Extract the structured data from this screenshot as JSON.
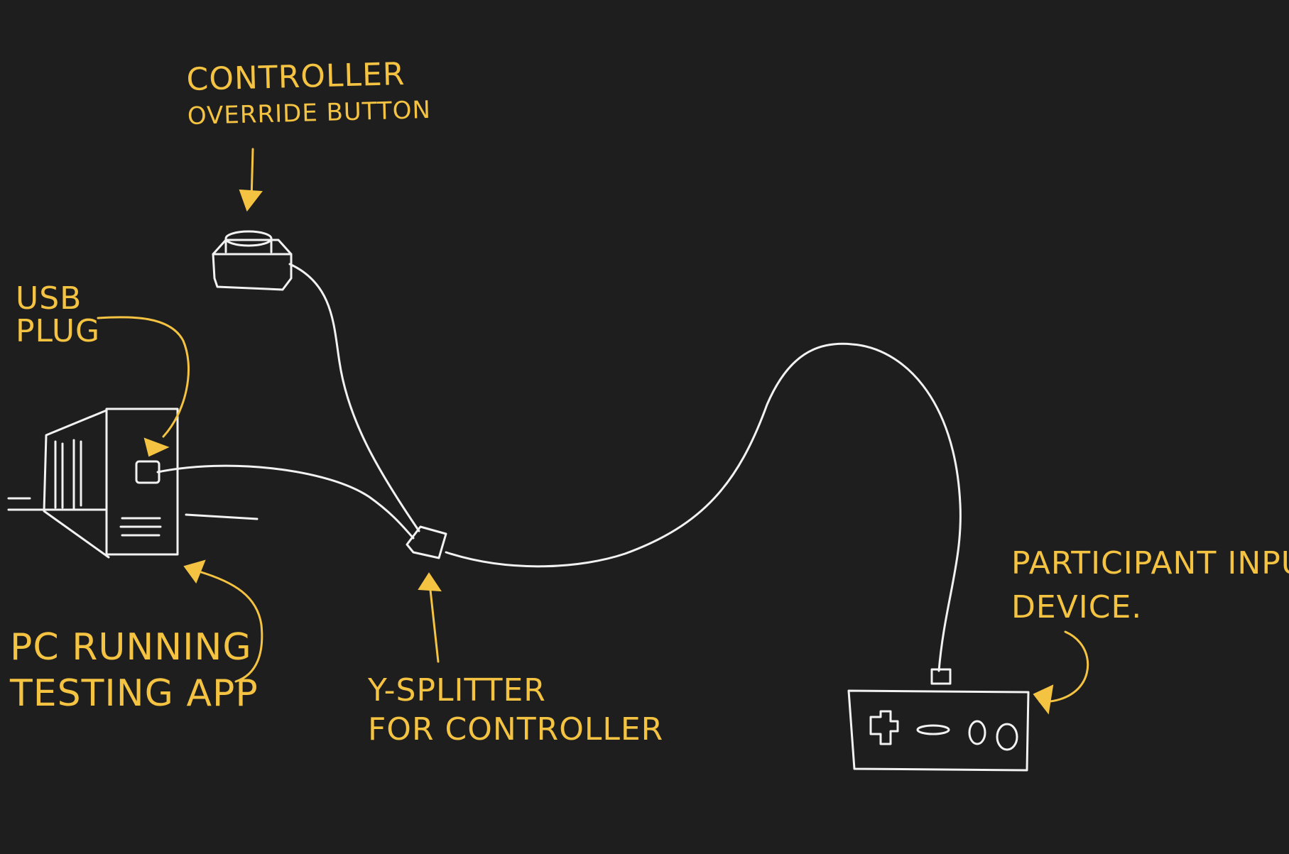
{
  "labels": {
    "controller_override": [
      "CONTROLLER",
      "OVERRIDE BUTTON"
    ],
    "usb_plug": [
      "USB",
      "PLUG"
    ],
    "pc": [
      "PC RUNNING",
      "TESTING APP"
    ],
    "y_splitter": [
      "Y-SPLITTER",
      "FOR CONTROLLER"
    ],
    "participant": [
      "PARTICIPANT INPUT",
      "DEVICE."
    ]
  },
  "colors": {
    "background": "#1e1e1e",
    "annotation": "#f5c342",
    "drawing": "#f2f2f2"
  }
}
